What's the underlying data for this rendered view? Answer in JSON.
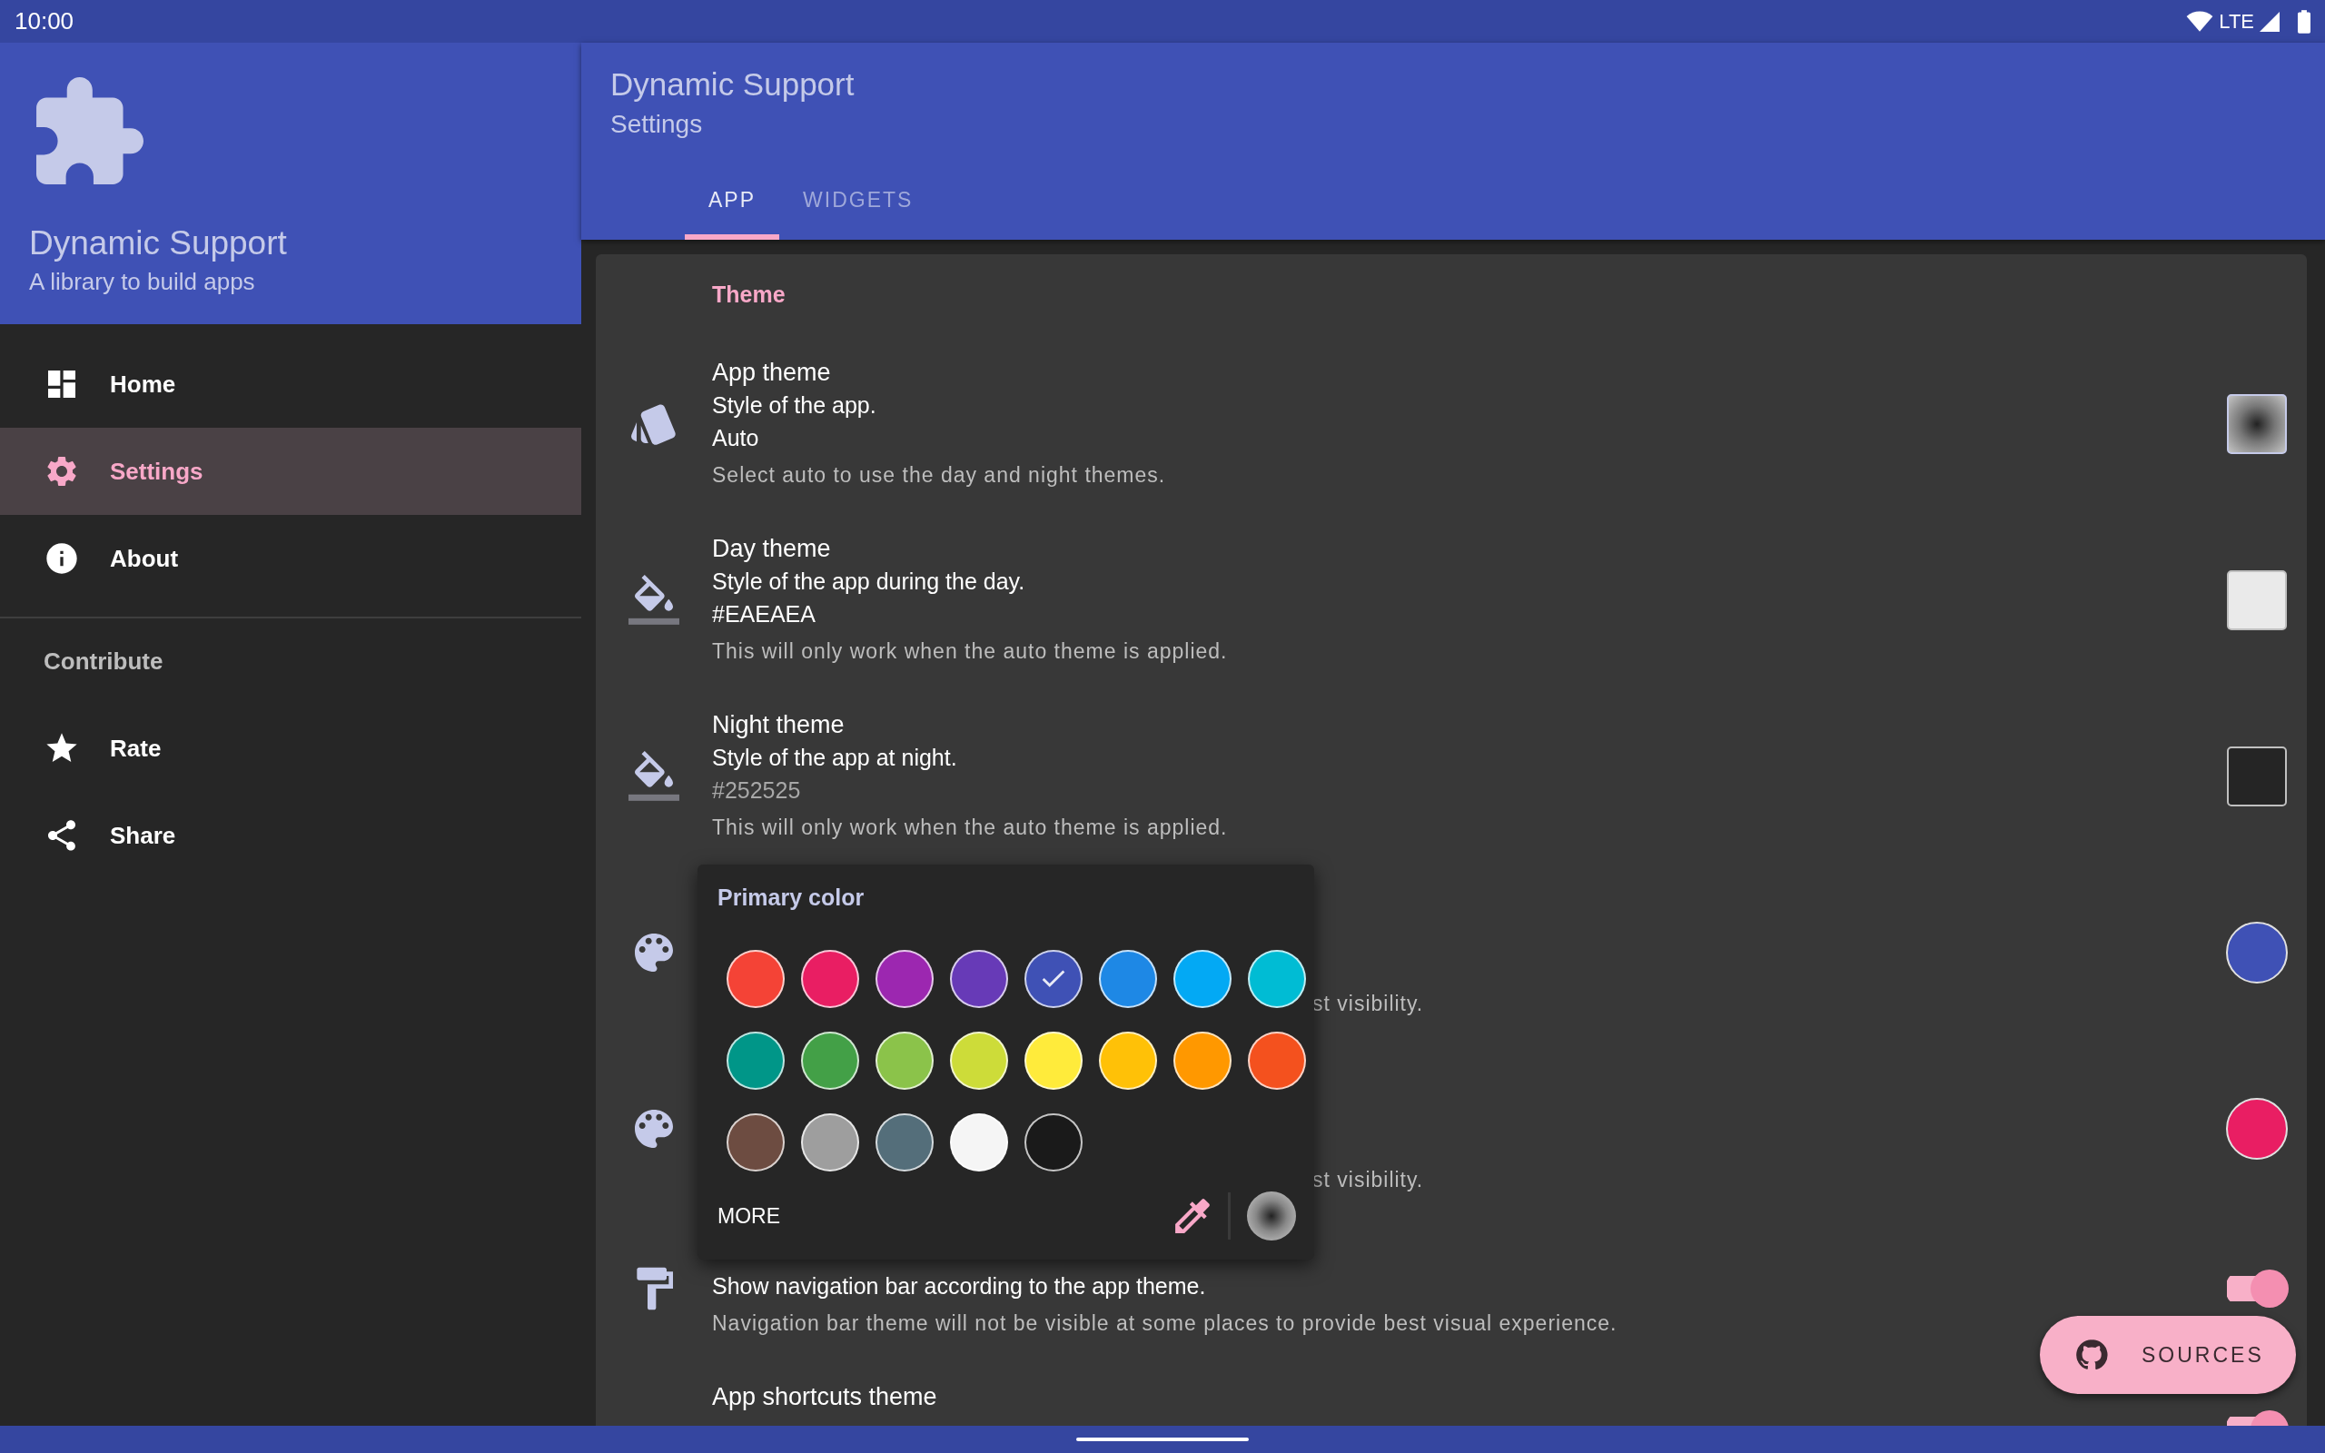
{
  "status_bar": {
    "time": "10:00",
    "network": "LTE"
  },
  "drawer": {
    "title": "Dynamic Support",
    "subtitle": "A library to build apps",
    "items": [
      {
        "label": "Home",
        "selected": false
      },
      {
        "label": "Settings",
        "selected": true
      },
      {
        "label": "About",
        "selected": false
      }
    ],
    "section": "Contribute",
    "contribute_items": [
      {
        "label": "Rate"
      },
      {
        "label": "Share"
      }
    ]
  },
  "app_bar": {
    "title": "Dynamic Support",
    "subtitle": "Settings"
  },
  "tabs": [
    {
      "label": "APP",
      "selected": true
    },
    {
      "label": "WIDGETS",
      "selected": false
    }
  ],
  "settings": {
    "section": "Theme",
    "rows": [
      {
        "title": "App theme",
        "summary": "Style of the app.",
        "value": "Auto",
        "description": "Select auto to use the day and night themes.",
        "widget": {
          "kind": "auto"
        }
      },
      {
        "title": "Day theme",
        "summary": "Style of the app during the day.",
        "value": "#EAEAEA",
        "description": "This will only work when the auto theme is applied.",
        "widget": {
          "kind": "square",
          "color": "#eaeaea"
        }
      },
      {
        "title": "Night theme",
        "summary": "Style of the app at night.",
        "value": "#252525",
        "value_dimmed": true,
        "description": "This will only work when the auto theme is applied.",
        "widget": {
          "kind": "square",
          "color": "#252525"
        }
      },
      {
        "hidden": true,
        "description": "st visibility.",
        "widget": {
          "kind": "circle",
          "color": "#3f51b5"
        }
      },
      {
        "hidden": true,
        "description": "st visibility.",
        "widget": {
          "kind": "circle",
          "color": "#e91e63"
        }
      },
      {
        "title_hidden": true,
        "summary": "Show navigation bar according to the app theme.",
        "description": "Navigation bar theme will not be visible at some places to provide best visual experience.",
        "widget": {
          "kind": "toggle",
          "on": true
        }
      },
      {
        "title": "App shortcuts theme",
        "widget": {
          "kind": "toggle",
          "on": true
        }
      }
    ]
  },
  "color_dialog": {
    "title": "Primary color",
    "more": "MORE",
    "swatches": [
      {
        "color": "#f44336",
        "selected": false
      },
      {
        "color": "#e91e63",
        "selected": false
      },
      {
        "color": "#9c27b0",
        "selected": false
      },
      {
        "color": "#673ab7",
        "selected": false
      },
      {
        "color": "#3f51b5",
        "selected": true
      },
      {
        "color": "#1e88e5",
        "selected": false
      },
      {
        "color": "#03a9f4",
        "selected": false
      },
      {
        "color": "#00bcd4",
        "selected": false
      },
      {
        "color": "#009688",
        "selected": false
      },
      {
        "color": "#43a047",
        "selected": false
      },
      {
        "color": "#8bc34a",
        "selected": false
      },
      {
        "color": "#cddc39",
        "selected": false
      },
      {
        "color": "#ffeb3b",
        "selected": false
      },
      {
        "color": "#ffc107",
        "selected": false
      },
      {
        "color": "#ff9800",
        "selected": false
      },
      {
        "color": "#f4511e",
        "selected": false
      },
      {
        "color": "#6d4c41",
        "selected": false
      },
      {
        "color": "#9e9e9e",
        "selected": false
      },
      {
        "color": "#546e7a",
        "selected": false
      },
      {
        "color": "#f5f5f5",
        "selected": false
      },
      {
        "color": "#1a1a1a",
        "selected": false
      }
    ]
  },
  "fab": {
    "label": "SOURCES"
  }
}
